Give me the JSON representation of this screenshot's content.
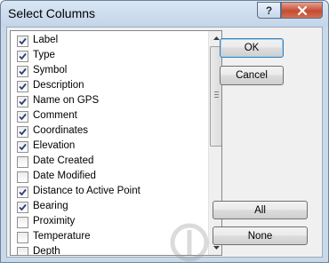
{
  "window": {
    "title": "Select Columns",
    "help_label": "?",
    "close_icon": "close-icon"
  },
  "columns": [
    {
      "label": "Label",
      "checked": true
    },
    {
      "label": "Type",
      "checked": true
    },
    {
      "label": "Symbol",
      "checked": true
    },
    {
      "label": "Description",
      "checked": true
    },
    {
      "label": "Name on GPS",
      "checked": true
    },
    {
      "label": "Comment",
      "checked": true
    },
    {
      "label": "Coordinates",
      "checked": true
    },
    {
      "label": "Elevation",
      "checked": true
    },
    {
      "label": "Date Created",
      "checked": false
    },
    {
      "label": "Date Modified",
      "checked": false
    },
    {
      "label": "Distance to Active Point",
      "checked": true
    },
    {
      "label": "Bearing",
      "checked": true
    },
    {
      "label": "Proximity",
      "checked": false
    },
    {
      "label": "Temperature",
      "checked": false
    },
    {
      "label": "Depth",
      "checked": false
    }
  ],
  "buttons": {
    "ok": "OK",
    "cancel": "Cancel",
    "all": "All",
    "none": "None"
  },
  "colors": {
    "frame": "#c9d9ea",
    "close_red": "#c54c31",
    "default_button_border": "#3c7fb1"
  }
}
